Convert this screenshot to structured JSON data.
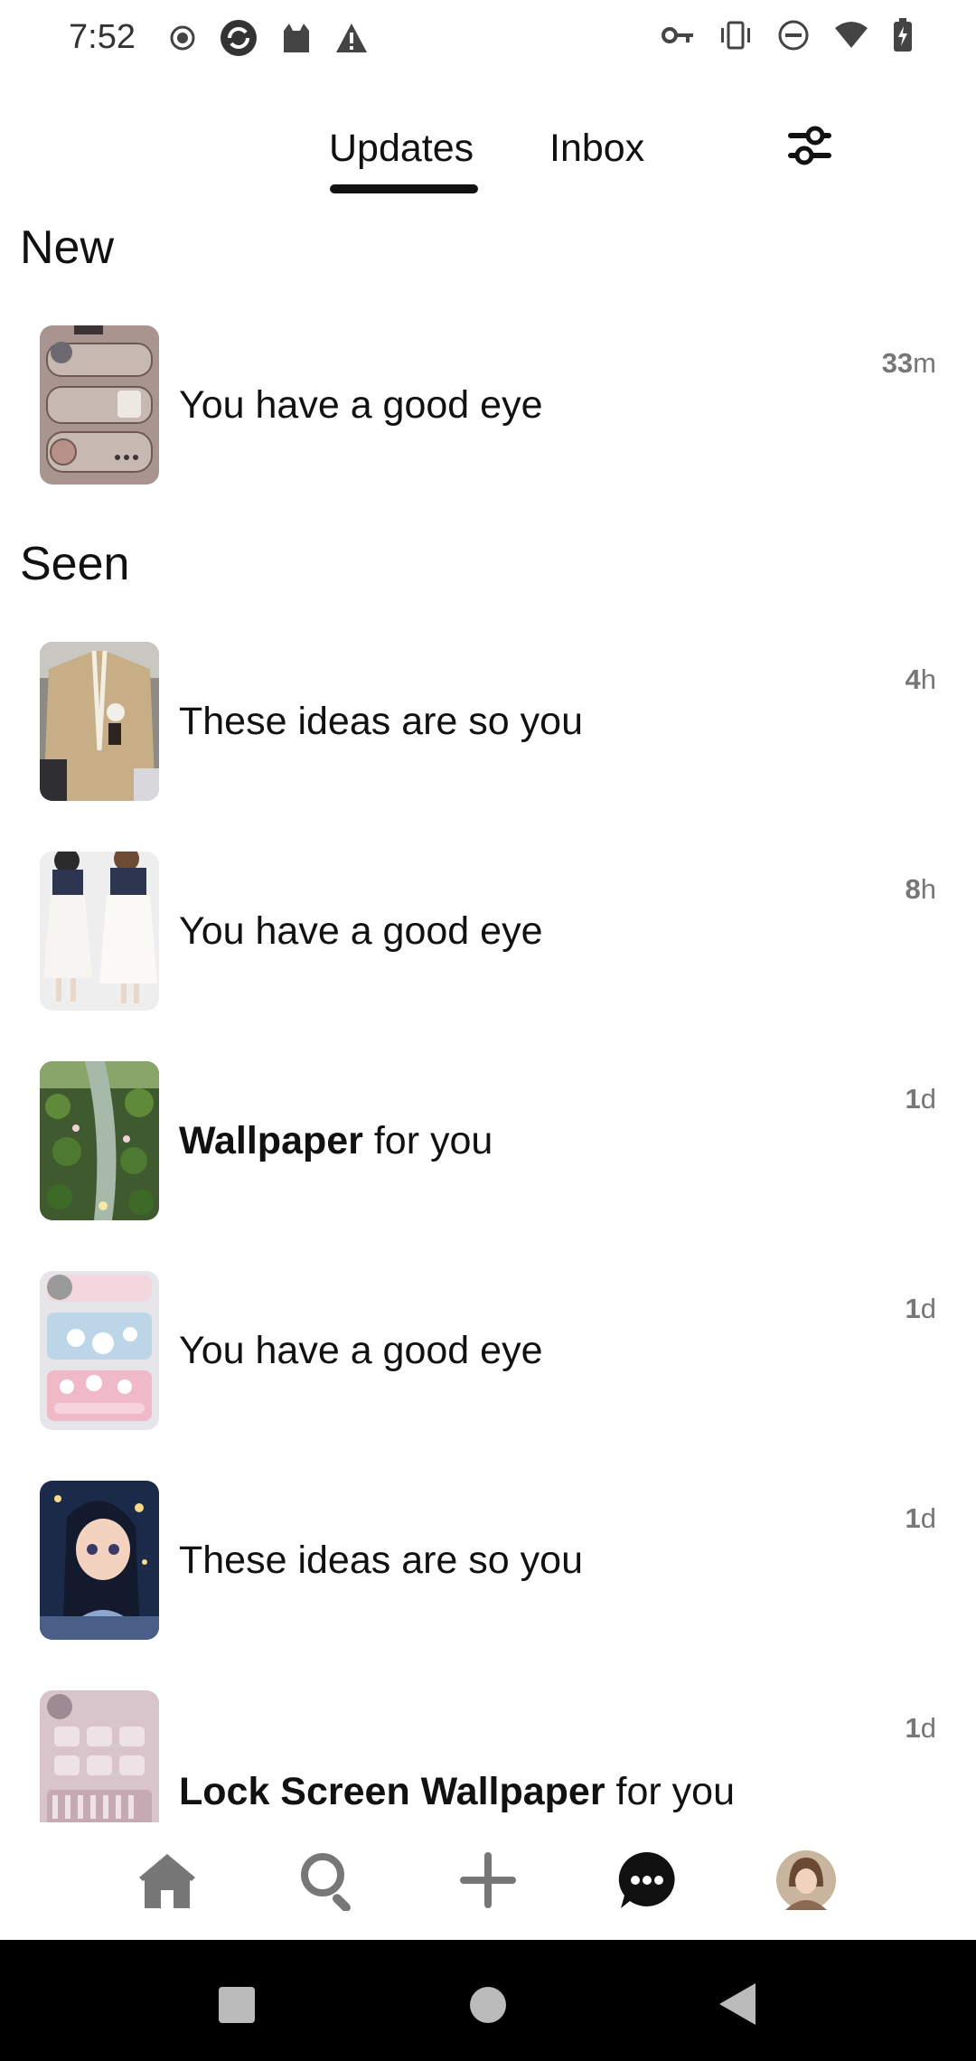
{
  "status_bar": {
    "time": "7:52",
    "left_icons": [
      "record-icon",
      "sync-icon",
      "cat-icon",
      "warning-icon"
    ],
    "right_icons": [
      "key-icon",
      "vibrate-icon",
      "dnd-icon",
      "wifi-icon",
      "battery-icon"
    ]
  },
  "tabs": {
    "updates": "Updates",
    "inbox": "Inbox",
    "active": "Updates"
  },
  "sections": {
    "new": "New",
    "seen": "Seen"
  },
  "notifications": [
    {
      "bold": "",
      "text": "You have a good eye",
      "time_num": "33",
      "time_unit": "m",
      "section": "New",
      "thumb": "phone-widget-thumbnail"
    },
    {
      "bold": "",
      "text": "These ideas are so you",
      "time_num": "4",
      "time_unit": "h",
      "section": "Seen",
      "thumb": "cardigan-thumbnail"
    },
    {
      "bold": "",
      "text": "You have a good eye",
      "time_num": "8",
      "time_unit": "h",
      "section": "Seen",
      "thumb": "white-dress-thumbnail"
    },
    {
      "bold": "Wallpaper",
      "text": " for you",
      "time_num": "1",
      "time_unit": "d",
      "section": "Seen",
      "thumb": "lily-pond-thumbnail"
    },
    {
      "bold": "",
      "text": "You have a good eye",
      "time_num": "1",
      "time_unit": "d",
      "section": "Seen",
      "thumb": "pink-widget-thumbnail"
    },
    {
      "bold": "",
      "text": "These ideas are so you",
      "time_num": "1",
      "time_unit": "d",
      "section": "Seen",
      "thumb": "anime-girl-thumbnail"
    },
    {
      "bold": "Lock Screen Wallpaper",
      "text": " for you",
      "time_num": "1",
      "time_unit": "d",
      "section": "Seen",
      "thumb": "lock-screen-thumbnail"
    }
  ],
  "bottom_nav": [
    "home-icon",
    "search-icon",
    "plus-icon",
    "chat-icon",
    "avatar"
  ],
  "colors": {
    "text": "#111111",
    "muted": "#777777",
    "background": "#ffffff",
    "system_nav": "#000000"
  }
}
